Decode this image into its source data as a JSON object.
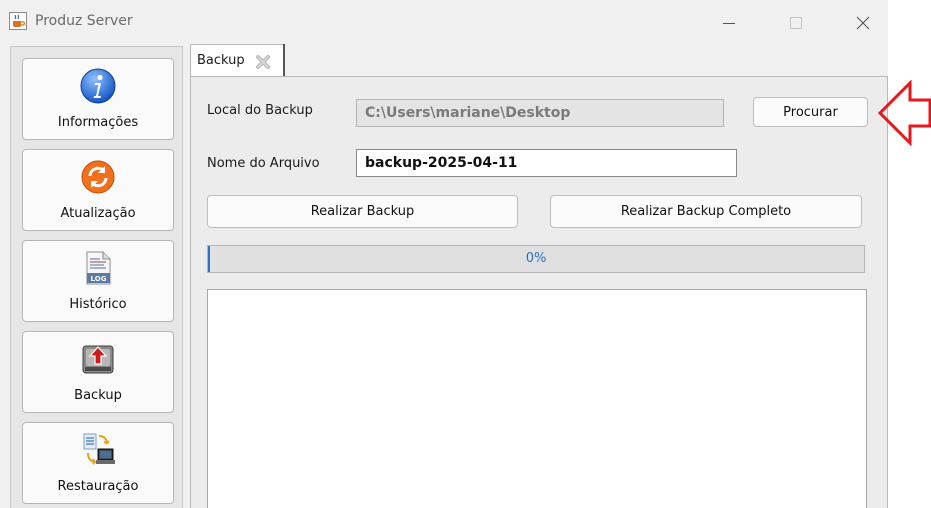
{
  "window": {
    "title": "Produz Server",
    "app_icon": "java-cup-icon",
    "controls": [
      "minimize-icon",
      "maximize-icon",
      "close-icon"
    ]
  },
  "sidebar": {
    "items": [
      {
        "label": "Informações",
        "icon": "info-icon"
      },
      {
        "label": "Atualização",
        "icon": "refresh-icon"
      },
      {
        "label": "Histórico",
        "icon": "log-file-icon"
      },
      {
        "label": "Backup",
        "icon": "backup-drive-icon"
      },
      {
        "label": "Restauração",
        "icon": "restore-computer-icon"
      }
    ]
  },
  "tabs": [
    {
      "label": "Backup",
      "close_icon": "tab-close-icon"
    }
  ],
  "backup": {
    "local_label": "Local do Backup",
    "local_value": "C:\\Users\\mariane\\Desktop",
    "browse_label": "Procurar",
    "filename_label": "Nome do Arquivo",
    "filename_value": "backup-2025-04-11",
    "backup_button": "Realizar Backup",
    "full_backup_button": "Realizar Backup Completo",
    "progress_text": "0%",
    "progress_value": 0,
    "log_text": ""
  },
  "annotation": {
    "icon": "red-left-arrow-icon",
    "color": "#e8171d"
  },
  "colors": {
    "progress_accent": "#2a6fc9",
    "window_bg": "#f0f0f0"
  }
}
